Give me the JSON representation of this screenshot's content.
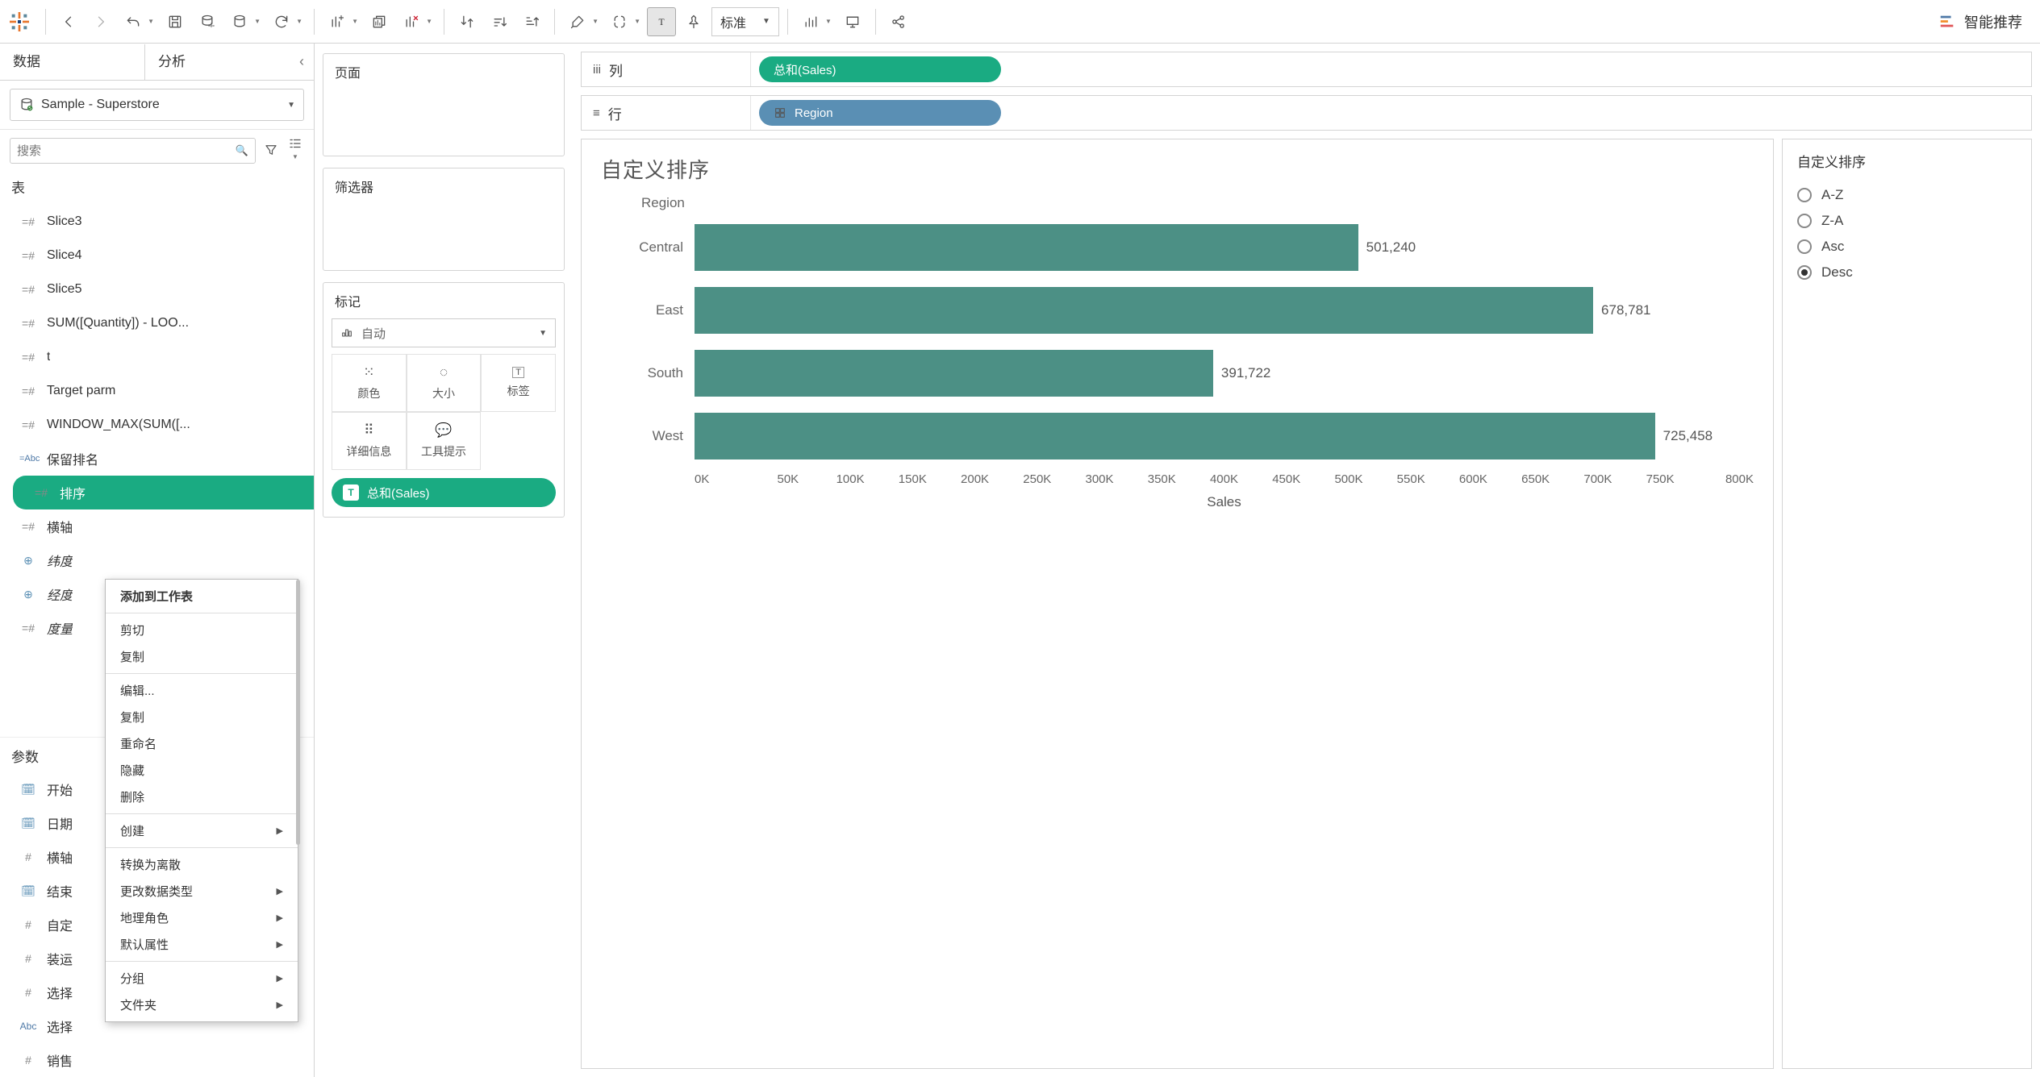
{
  "toolbar": {
    "fit_label": "标准",
    "smart_rec_label": "智能推荐"
  },
  "sidebar": {
    "tabs": {
      "data": "数据",
      "analysis": "分析"
    },
    "datasource": "Sample - Superstore",
    "search_placeholder": "搜索",
    "section_table": "表",
    "section_params": "参数",
    "fields": [
      {
        "icon": "=#",
        "label": "Slice3"
      },
      {
        "icon": "=#",
        "label": "Slice4"
      },
      {
        "icon": "=#",
        "label": "Slice5"
      },
      {
        "icon": "=#",
        "label": "SUM([Quantity]) - LOO..."
      },
      {
        "icon": "=#",
        "label": "t"
      },
      {
        "icon": "=#",
        "label": "Target parm"
      },
      {
        "icon": "=#",
        "label": "WINDOW_MAX(SUM([..."
      },
      {
        "icon": "=Abc",
        "label": "保留排名",
        "abc": true
      },
      {
        "icon": "=#",
        "label": "排序",
        "selected": true
      },
      {
        "icon": "=#",
        "label": "横轴"
      },
      {
        "icon": "⊕",
        "label": "纬度",
        "italic": true,
        "globe": true
      },
      {
        "icon": "⊕",
        "label": "经度",
        "italic": true,
        "globe": true
      },
      {
        "icon": "=#",
        "label": "度量",
        "italic": true
      }
    ],
    "params": [
      {
        "icon": "cal",
        "label": "开始"
      },
      {
        "icon": "cal",
        "label": "日期"
      },
      {
        "icon": "#",
        "label": "横轴"
      },
      {
        "icon": "cal",
        "label": "结束"
      },
      {
        "icon": "#",
        "label": "自定"
      },
      {
        "icon": "#",
        "label": "装运"
      },
      {
        "icon": "#",
        "label": "选择"
      },
      {
        "icon": "Abc",
        "label": "选择",
        "abc": true
      },
      {
        "icon": "#",
        "label": "销售"
      }
    ]
  },
  "context_menu": {
    "items": [
      {
        "label": "添加到工作表",
        "bold": true
      },
      {
        "divider": true
      },
      {
        "label": "剪切"
      },
      {
        "label": "复制"
      },
      {
        "divider": true
      },
      {
        "label": "编辑..."
      },
      {
        "label": "复制"
      },
      {
        "label": "重命名"
      },
      {
        "label": "隐藏"
      },
      {
        "label": "删除"
      },
      {
        "divider": true
      },
      {
        "label": "创建",
        "sub": true
      },
      {
        "divider": true
      },
      {
        "label": "转换为离散"
      },
      {
        "label": "更改数据类型",
        "sub": true
      },
      {
        "label": "地理角色",
        "sub": true
      },
      {
        "label": "默认属性",
        "sub": true
      },
      {
        "divider": true
      },
      {
        "label": "分组",
        "sub": true
      },
      {
        "label": "文件夹",
        "sub": true
      }
    ]
  },
  "shelves": {
    "pages_label": "页面",
    "filters_label": "筛选器",
    "marks_label": "标记",
    "marks_type": "自动",
    "marks_cells": {
      "color": "颜色",
      "size": "大小",
      "label": "标签",
      "detail": "详细信息",
      "tooltip": "工具提示"
    },
    "marks_pill": "总和(Sales)",
    "columns_label": "列",
    "rows_label": "行",
    "columns_pill": "总和(Sales)",
    "rows_pill": "Region"
  },
  "viz": {
    "title": "自定义排序",
    "header": "Region",
    "axis_label": "Sales",
    "param_title": "自定义排序",
    "options": [
      "A-Z",
      "Z-A",
      "Asc",
      "Desc"
    ],
    "selected_option": "Desc"
  },
  "chart_data": {
    "type": "bar",
    "orientation": "horizontal",
    "categories": [
      "Central",
      "East",
      "South",
      "West"
    ],
    "values": [
      501240,
      678781,
      391722,
      725458
    ],
    "value_labels": [
      "501,240",
      "678,781",
      "391,722",
      "725,458"
    ],
    "xlabel": "Sales",
    "ylabel": "Region",
    "xlim": [
      0,
      800000
    ],
    "ticks": [
      "0K",
      "50K",
      "100K",
      "150K",
      "200K",
      "250K",
      "300K",
      "350K",
      "400K",
      "450K",
      "500K",
      "550K",
      "600K",
      "650K",
      "700K",
      "750K",
      "800K"
    ],
    "color": "#4c9085"
  }
}
